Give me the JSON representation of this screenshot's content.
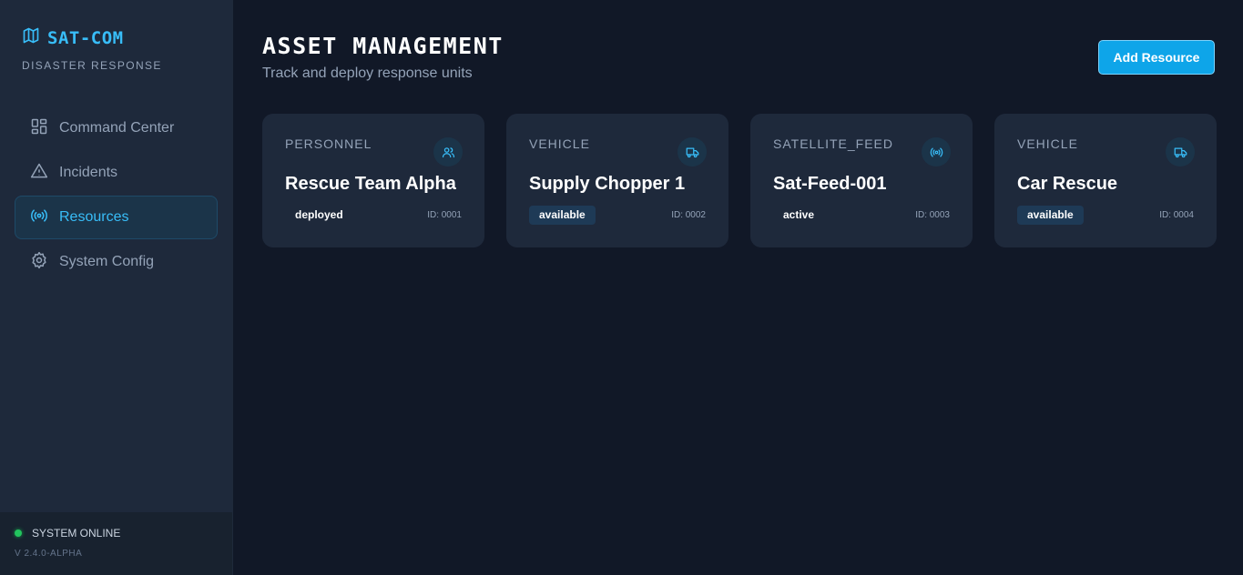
{
  "brand": {
    "title": "SAT-COM",
    "subtitle": "DISASTER RESPONSE",
    "icon": "map-icon",
    "accent": "#38bdf8"
  },
  "nav": {
    "items": [
      {
        "label": "Command Center",
        "icon": "grid-icon",
        "active": false
      },
      {
        "label": "Incidents",
        "icon": "alert-triangle-icon",
        "active": false
      },
      {
        "label": "Resources",
        "icon": "radio-signal-icon",
        "active": true
      },
      {
        "label": "System Config",
        "icon": "gear-icon",
        "active": false
      }
    ]
  },
  "status": {
    "label": "SYSTEM ONLINE",
    "version": "V 2.4.0-ALPHA",
    "color": "#22c55e"
  },
  "header": {
    "title": "ASSET MANAGEMENT",
    "subtitle": "Track and deploy response units",
    "add_button": "Add Resource"
  },
  "resources": [
    {
      "type": "PERSONNEL",
      "name": "Rescue Team Alpha",
      "status": "deployed",
      "id": "ID: 0001",
      "icon": "users-icon"
    },
    {
      "type": "VEHICLE",
      "name": "Supply Chopper 1",
      "status": "available",
      "id": "ID: 0002",
      "icon": "truck-icon"
    },
    {
      "type": "SATELLITE_FEED",
      "name": "Sat-Feed-001",
      "status": "active",
      "id": "ID: 0003",
      "icon": "radio-signal-icon"
    },
    {
      "type": "VEHICLE",
      "name": "Car Rescue",
      "status": "available",
      "id": "ID: 0004",
      "icon": "truck-icon"
    }
  ]
}
